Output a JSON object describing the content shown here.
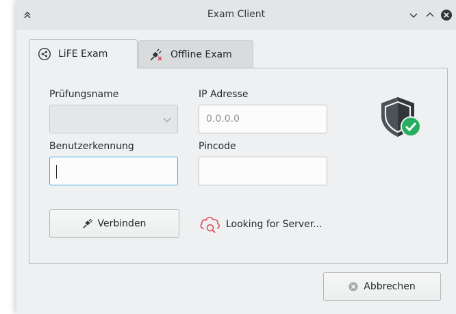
{
  "window": {
    "title": "Exam Client"
  },
  "tabs": [
    {
      "label": "LiFE Exam",
      "icon": "share-circle-icon",
      "active": true
    },
    {
      "label": "Offline Exam",
      "icon": "disconnected-plug-icon",
      "active": false
    }
  ],
  "form": {
    "exam_name_label": "Prüfungsname",
    "exam_name_value": "",
    "ip_label": "IP Adresse",
    "ip_placeholder": "0.0.0.0",
    "user_label": "Benutzerkennung",
    "user_value": "",
    "pin_label": "Pincode",
    "pin_value": ""
  },
  "actions": {
    "connect_label": "Verbinden",
    "cancel_label": "Abbrechen"
  },
  "status": {
    "text": "Looking for Server...",
    "icon": "cloud-search-icon"
  },
  "security": {
    "icon": "shield-check-icon"
  },
  "colors": {
    "accent_focus": "#3daee9",
    "check_green": "#27ae60",
    "status_red": "#da4453",
    "shield_dark": "#31363b"
  }
}
